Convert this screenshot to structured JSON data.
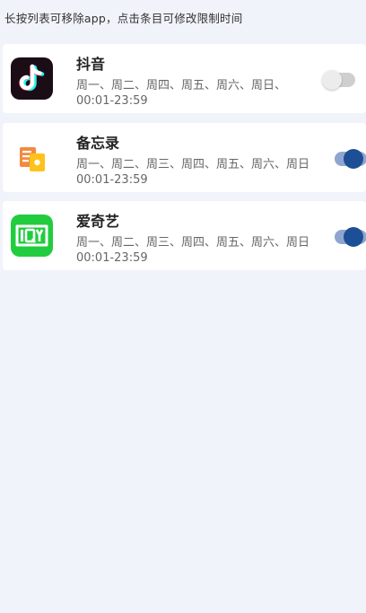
{
  "hint_text": "长按列表可移除app，点击条目可修改限制时间",
  "colors": {
    "background": "#f1f3fa",
    "card": "#ffffff",
    "toggle_on": "#1d4f96",
    "toggle_off": "#ececec"
  },
  "apps": [
    {
      "name": "抖音",
      "days": "周一、周二、周四、周五、周六、周日、",
      "time": "00:01-23:59",
      "enabled": false,
      "icon": "tiktok-icon"
    },
    {
      "name": "备忘录",
      "days": "周一、周二、周三、周四、周五、周六、周日",
      "time": "00:01-23:59",
      "enabled": true,
      "icon": "notes-icon"
    },
    {
      "name": "爱奇艺",
      "days": "周一、周二、周三、周四、周五、周六、周日",
      "time": "00:01-23:59",
      "enabled": true,
      "icon": "iqiyi-icon"
    }
  ]
}
